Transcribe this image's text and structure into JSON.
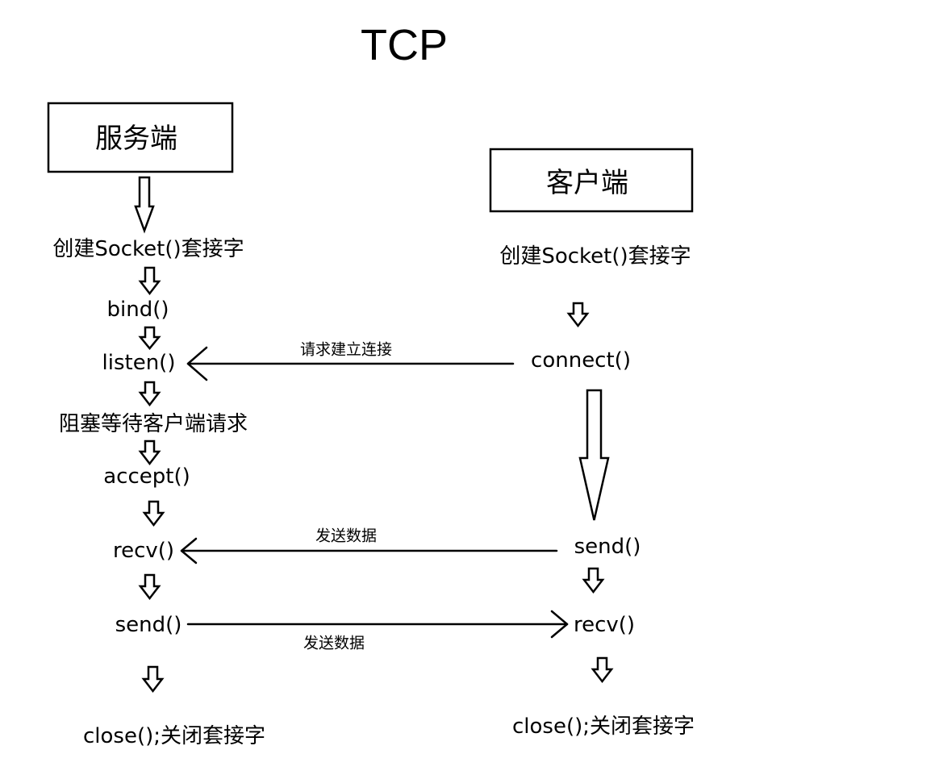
{
  "title": "TCP",
  "server": {
    "header": "服务端",
    "steps": {
      "create": "创建Socket()套接字",
      "bind": "bind()",
      "listen": "listen()",
      "wait": "阻塞等待客户端请求",
      "accept": "accept()",
      "recv": "recv()",
      "send": "send()",
      "close": "close();关闭套接字"
    }
  },
  "client": {
    "header": "客户端",
    "steps": {
      "create": "创建Socket()套接字",
      "connect": "connect()",
      "send": "send()",
      "recv": "recv()",
      "close": "close();关闭套接字"
    }
  },
  "edges": {
    "connect_request": "请求建立连接",
    "client_send": "发送数据",
    "server_send": "发送数据"
  },
  "colors": {
    "stroke": "#000000",
    "background": "#ffffff"
  }
}
